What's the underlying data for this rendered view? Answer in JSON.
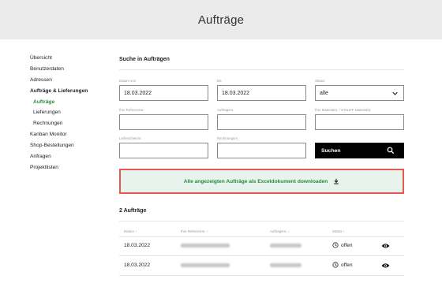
{
  "header": {
    "title": "Aufträge"
  },
  "sidebar": {
    "items": [
      {
        "label": "Übersicht"
      },
      {
        "label": "Benutzerdaten"
      },
      {
        "label": "Adressen"
      },
      {
        "label": "Aufträge & Lieferungen"
      },
      {
        "label": "Aufträge"
      },
      {
        "label": "Lieferungen"
      },
      {
        "label": "Rechnungen"
      },
      {
        "label": "Kanban Monitor"
      },
      {
        "label": "Shop-Bestellungen"
      },
      {
        "label": "Anfragen"
      },
      {
        "label": "Projektlisten"
      }
    ]
  },
  "search": {
    "title": "Suche in Aufträgen",
    "datum_von": {
      "label": "Datum von",
      "value": "18.03.2022"
    },
    "bis": {
      "label": "bis",
      "value": "18.03.2022"
    },
    "status": {
      "label": "Status",
      "value": "alle"
    },
    "referenz": {
      "label": "Ihre Referenznr.",
      "value": ""
    },
    "auftragsnr": {
      "label": "Auftragsnr.",
      "value": ""
    },
    "materialnr": {
      "label": "Ihre Materialnr. / STAUFF Materialnr.",
      "value": ""
    },
    "lieferscheinnr": {
      "label": "Lieferscheinnr.",
      "value": ""
    },
    "rechnungsnr": {
      "label": "Rechnungsnr.",
      "value": ""
    },
    "button_label": "Suchen"
  },
  "download": {
    "label": "Alle angezeigten Aufträge als Exceldokument downloaden"
  },
  "results": {
    "title": "2 Aufträge",
    "columns": {
      "datum": "Datum ↑",
      "referenz": "Ihre Referenznr. ↑",
      "auftrag": "Auftragsnr. ↓",
      "status": "Status ↑"
    },
    "rows": [
      {
        "datum": "18.03.2022",
        "status": "offen"
      },
      {
        "datum": "18.03.2022",
        "status": "offen"
      }
    ]
  },
  "colors": {
    "accent": "#2a8a3e",
    "download_bg": "#e7f3ec",
    "highlight_border": "#e55a50",
    "header_bg": "#ebebeb"
  }
}
